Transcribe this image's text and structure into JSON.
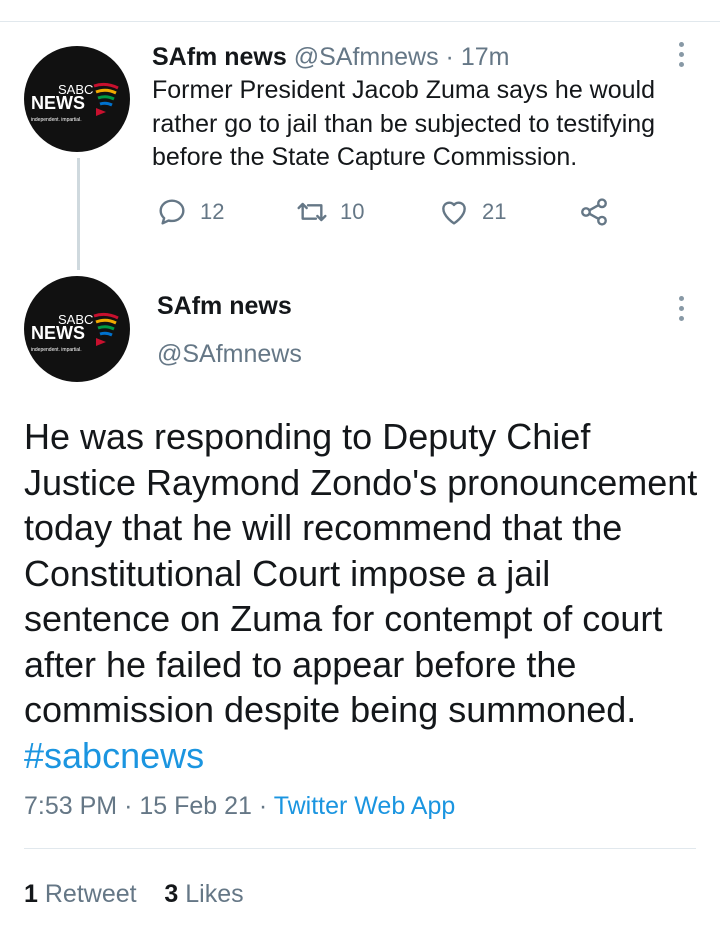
{
  "tweet1": {
    "name": "SAfm news",
    "handle": "@SAfmnews",
    "separator": "·",
    "time": "17m",
    "text": "Former President Jacob Zuma says he would rather go to jail than be subjected to testifying before the State Capture Commission.",
    "replies": "12",
    "retweets": "10",
    "likes": "21"
  },
  "tweet2": {
    "name": "SAfm news",
    "handle": "@SAfmnews",
    "text": "He was responding to Deputy Chief Justice Raymond Zondo's pronouncement today that he will recommend that the Constitutional Court impose a jail sentence on Zuma for contempt of court after he failed to appear before the commission despite being summoned.",
    "hashtag": "#sabcnews",
    "time": "7:53 PM",
    "sep1": "·",
    "date": "15 Feb 21",
    "sep2": "·",
    "source": "Twitter Web App",
    "retweet_count": "1",
    "retweet_label": "Retweet",
    "like_count": "3",
    "like_label": "Likes"
  },
  "avatar_logo": {
    "line1": "SABC",
    "line2": "NEWS",
    "tagline": "independent. impartial."
  },
  "colors": {
    "link": "#1b95e0",
    "muted": "#657786",
    "text": "#14171a"
  },
  "icons": [
    "reply-icon",
    "retweet-icon",
    "like-icon",
    "share-icon",
    "more-options-icon"
  ]
}
